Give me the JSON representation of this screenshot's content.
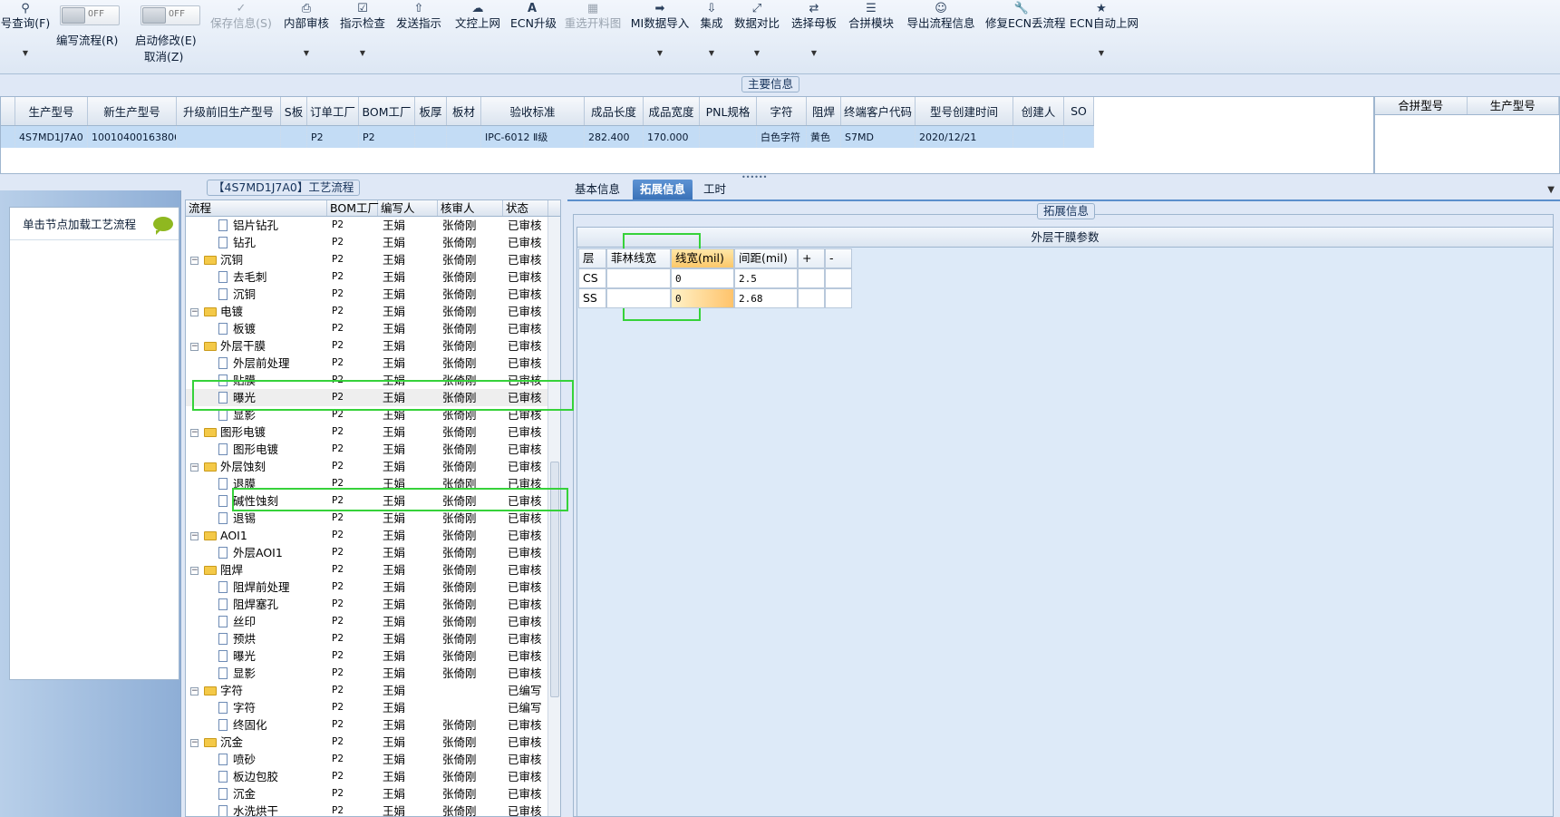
{
  "toolbar": {
    "items": [
      {
        "icon": "search-icon",
        "label": "号查询(F)"
      },
      {
        "label": "编写流程(R)",
        "toggle": "OFF"
      },
      {
        "label": "启动修改(E)",
        "sub": "取消(Z)",
        "toggle": "OFF"
      },
      {
        "icon": "check-icon",
        "label": "保存信息(S)",
        "disabled": true
      },
      {
        "icon": "printer-icon",
        "label": "内部审核"
      },
      {
        "icon": "checkbox-icon",
        "label": "指示检查"
      },
      {
        "icon": "upload-icon",
        "label": "发送指示"
      },
      {
        "icon": "cloud-upload-icon",
        "label": "文控上网"
      },
      {
        "icon": "font-a-icon",
        "label": "ECN升级"
      },
      {
        "icon": "image-icon",
        "label": "重选开料图",
        "disabled": true
      },
      {
        "icon": "login-icon",
        "label": "MI数据导入"
      },
      {
        "icon": "download-icon",
        "label": "集成"
      },
      {
        "icon": "compress-icon",
        "label": "数据对比"
      },
      {
        "icon": "shuffle-icon",
        "label": "选择母板"
      },
      {
        "icon": "list-icon",
        "label": "合拼模块"
      },
      {
        "icon": "smile-icon",
        "label": "导出流程信息"
      },
      {
        "icon": "wrench-icon",
        "label": "修复ECN丢流程"
      },
      {
        "icon": "star-icon",
        "label": "ECN自动上网"
      }
    ]
  },
  "main_info": {
    "caption": "主要信息",
    "columns": [
      "生产型号",
      "新生产型号",
      "升级前旧生产型号",
      "S板",
      "订单工厂",
      "BOM工厂",
      "板厚",
      "板材",
      "验收标准",
      "成品长度",
      "成品宽度",
      "PNL规格",
      "字符",
      "阻焊",
      "终端客户代码",
      "型号创建时间",
      "创建人",
      "SO"
    ],
    "row": [
      "4S7MD1J7A0",
      "10010400163806",
      "",
      "",
      "P2",
      "P2",
      "",
      "",
      "IPC-6012 Ⅱ级",
      "282.400",
      "170.000",
      "",
      "白色字符",
      "黄色",
      "S7MD",
      "2020/12/21",
      "",
      ""
    ],
    "right_columns": [
      "合拼型号",
      "生产型号"
    ]
  },
  "left_nav": {
    "load_label": "单击节点加载工艺流程"
  },
  "process_tree": {
    "caption": "【4S7MD1J7A0】工艺流程",
    "columns": [
      "流程",
      "BOM工厂",
      "编写人",
      "核审人",
      "状态"
    ],
    "rows": [
      {
        "name": "铝片钻孔",
        "level": 2,
        "bom": "P2",
        "author": "王娟",
        "reviewer": "张倚刚",
        "status": "已审核"
      },
      {
        "name": "钻孔",
        "level": 2,
        "bom": "P2",
        "author": "王娟",
        "reviewer": "张倚刚",
        "status": "已审核"
      },
      {
        "name": "沉铜",
        "level": 1,
        "bom": "P2",
        "author": "王娟",
        "reviewer": "张倚刚",
        "status": "已审核"
      },
      {
        "name": "去毛刺",
        "level": 2,
        "bom": "P2",
        "author": "王娟",
        "reviewer": "张倚刚",
        "status": "已审核"
      },
      {
        "name": "沉铜",
        "level": 2,
        "bom": "P2",
        "author": "王娟",
        "reviewer": "张倚刚",
        "status": "已审核"
      },
      {
        "name": "电镀",
        "level": 1,
        "bom": "P2",
        "author": "王娟",
        "reviewer": "张倚刚",
        "status": "已审核"
      },
      {
        "name": "板镀",
        "level": 2,
        "bom": "P2",
        "author": "王娟",
        "reviewer": "张倚刚",
        "status": "已审核"
      },
      {
        "name": "外层干膜",
        "level": 1,
        "bom": "P2",
        "author": "王娟",
        "reviewer": "张倚刚",
        "status": "已审核"
      },
      {
        "name": "外层前处理",
        "level": 2,
        "bom": "P2",
        "author": "王娟",
        "reviewer": "张倚刚",
        "status": "已审核"
      },
      {
        "name": "贴膜",
        "level": 2,
        "bom": "P2",
        "author": "王娟",
        "reviewer": "张倚刚",
        "status": "已审核"
      },
      {
        "name": "曝光",
        "level": 2,
        "bom": "P2",
        "author": "王娟",
        "reviewer": "张倚刚",
        "status": "已审核",
        "selected": true
      },
      {
        "name": "显影",
        "level": 2,
        "bom": "P2",
        "author": "王娟",
        "reviewer": "张倚刚",
        "status": "已审核"
      },
      {
        "name": "图形电镀",
        "level": 1,
        "bom": "P2",
        "author": "王娟",
        "reviewer": "张倚刚",
        "status": "已审核"
      },
      {
        "name": "图形电镀",
        "level": 2,
        "bom": "P2",
        "author": "王娟",
        "reviewer": "张倚刚",
        "status": "已审核"
      },
      {
        "name": "外层蚀刻",
        "level": 1,
        "bom": "P2",
        "author": "王娟",
        "reviewer": "张倚刚",
        "status": "已审核"
      },
      {
        "name": "退膜",
        "level": 2,
        "bom": "P2",
        "author": "王娟",
        "reviewer": "张倚刚",
        "status": "已审核"
      },
      {
        "name": "碱性蚀刻",
        "level": 2,
        "bom": "P2",
        "author": "王娟",
        "reviewer": "张倚刚",
        "status": "已审核"
      },
      {
        "name": "退锡",
        "level": 2,
        "bom": "P2",
        "author": "王娟",
        "reviewer": "张倚刚",
        "status": "已审核"
      },
      {
        "name": "AOI1",
        "level": 1,
        "bom": "P2",
        "author": "王娟",
        "reviewer": "张倚刚",
        "status": "已审核"
      },
      {
        "name": "外层AOI1",
        "level": 2,
        "bom": "P2",
        "author": "王娟",
        "reviewer": "张倚刚",
        "status": "已审核"
      },
      {
        "name": "阻焊",
        "level": 1,
        "bom": "P2",
        "author": "王娟",
        "reviewer": "张倚刚",
        "status": "已审核"
      },
      {
        "name": "阻焊前处理",
        "level": 2,
        "bom": "P2",
        "author": "王娟",
        "reviewer": "张倚刚",
        "status": "已审核"
      },
      {
        "name": "阻焊塞孔",
        "level": 2,
        "bom": "P2",
        "author": "王娟",
        "reviewer": "张倚刚",
        "status": "已审核"
      },
      {
        "name": "丝印",
        "level": 2,
        "bom": "P2",
        "author": "王娟",
        "reviewer": "张倚刚",
        "status": "已审核"
      },
      {
        "name": "预烘",
        "level": 2,
        "bom": "P2",
        "author": "王娟",
        "reviewer": "张倚刚",
        "status": "已审核"
      },
      {
        "name": "曝光",
        "level": 2,
        "bom": "P2",
        "author": "王娟",
        "reviewer": "张倚刚",
        "status": "已审核"
      },
      {
        "name": "显影",
        "level": 2,
        "bom": "P2",
        "author": "王娟",
        "reviewer": "张倚刚",
        "status": "已审核"
      },
      {
        "name": "字符",
        "level": 1,
        "bom": "P2",
        "author": "王娟",
        "reviewer": "",
        "status": "已编写"
      },
      {
        "name": "字符",
        "level": 2,
        "bom": "P2",
        "author": "王娟",
        "reviewer": "",
        "status": "已编写"
      },
      {
        "name": "终固化",
        "level": 2,
        "bom": "P2",
        "author": "王娟",
        "reviewer": "张倚刚",
        "status": "已审核"
      },
      {
        "name": "沉金",
        "level": 1,
        "bom": "P2",
        "author": "王娟",
        "reviewer": "张倚刚",
        "status": "已审核"
      },
      {
        "name": "喷砂",
        "level": 2,
        "bom": "P2",
        "author": "王娟",
        "reviewer": "张倚刚",
        "status": "已审核"
      },
      {
        "name": "板边包胶",
        "level": 2,
        "bom": "P2",
        "author": "王娟",
        "reviewer": "张倚刚",
        "status": "已审核"
      },
      {
        "name": "沉金",
        "level": 2,
        "bom": "P2",
        "author": "王娟",
        "reviewer": "张倚刚",
        "status": "已审核"
      },
      {
        "name": "水洗烘干",
        "level": 2,
        "bom": "P2",
        "author": "王娟",
        "reviewer": "张倚刚",
        "status": "已审核"
      }
    ]
  },
  "detail": {
    "tabs": [
      "基本信息",
      "拓展信息",
      "工时"
    ],
    "active_tab": 1,
    "caption": "拓展信息",
    "param_title": "外层干膜参数",
    "param_columns": [
      "层",
      "菲林线宽",
      "线宽(mil)",
      "间距(mil)",
      "+",
      "-"
    ],
    "param_rows": [
      [
        "CS",
        "",
        "0",
        "2.5",
        "",
        ""
      ],
      [
        "SS",
        "",
        "0",
        "2.68",
        "",
        ""
      ]
    ]
  },
  "colors": {
    "highlight": "#36d23a",
    "selected_row": "#c3dcf5",
    "active_tab": "#3a72b8"
  }
}
